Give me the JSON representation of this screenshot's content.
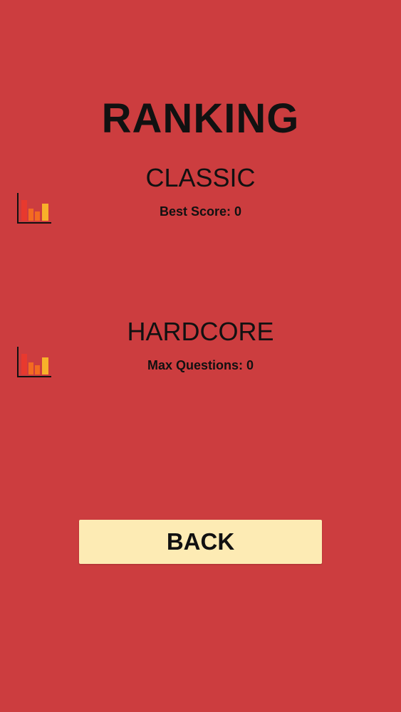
{
  "screen": {
    "title": "RANKING"
  },
  "modes": {
    "classic": {
      "title": "CLASSIC",
      "stat_label": "Best Score:",
      "stat_value": "0",
      "icon": "bar-chart-icon"
    },
    "hardcore": {
      "title": "HARDCORE",
      "stat_label": "Max Questions:",
      "stat_value": "0",
      "icon": "bar-chart-icon"
    }
  },
  "back_button": {
    "label": "BACK"
  },
  "colors": {
    "background": "#cc3d3f",
    "button_background": "#fdebb4",
    "text": "#111111",
    "icon_bar_red": "#e8392e",
    "icon_bar_orange": "#f36b21",
    "icon_bar_yellow": "#f8b12a"
  }
}
